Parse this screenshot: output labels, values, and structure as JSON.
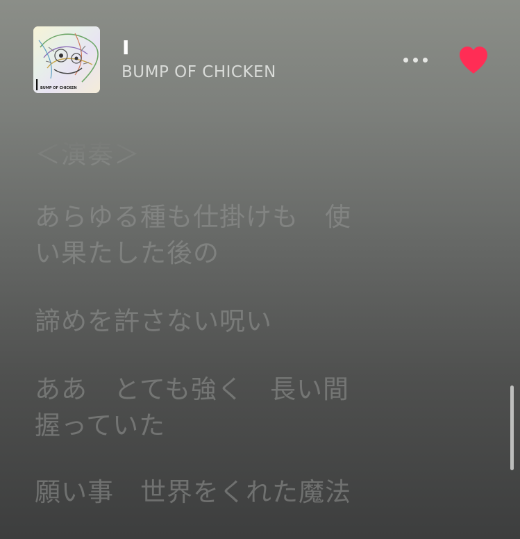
{
  "now_playing": {
    "title": "I",
    "artist": "BUMP OF CHICKEN",
    "artwork_label": "BUMP OF CHICKEN",
    "artwork_mark": "I",
    "loved": true
  },
  "icons": {
    "more": "more-horizontal-icon",
    "love": "heart-filled-icon"
  },
  "colors": {
    "accent": "#ff2d55",
    "title_text": "#ffffff",
    "artist_text": "#d9dbd8",
    "lyric_text": "#9a9c9a"
  },
  "lyrics": {
    "lines": [
      "＜演奏＞",
      "あらゆる種も仕掛けも　使",
      "い果たした後の",
      "諦めを許さない呪い",
      "ああ　とても強く　長い間",
      "握っていた",
      "願い事　世界をくれた魔法"
    ]
  }
}
